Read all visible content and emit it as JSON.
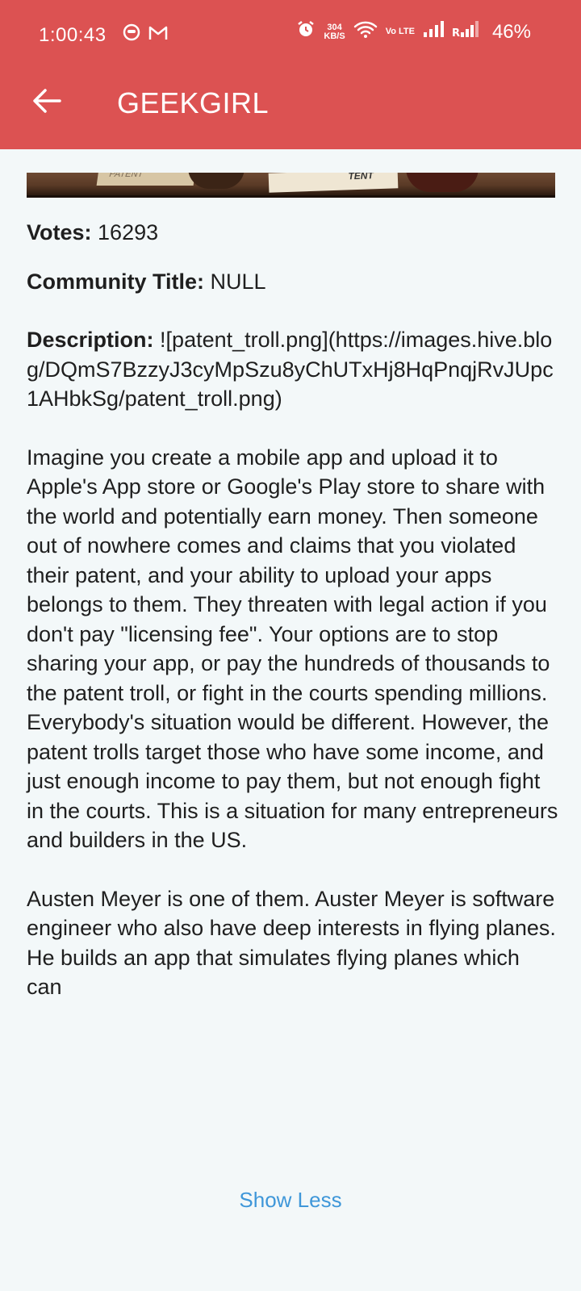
{
  "status_bar": {
    "time": "1:00:43",
    "speed_value": "304",
    "speed_unit": "KB/S",
    "network_label": "Vo LTE",
    "battery": "46%"
  },
  "app_bar": {
    "title": "GEEKGIRL",
    "background_color": "#dc5252"
  },
  "banner": {
    "paper_left_text": "PATENT",
    "paper_right_text": "TENT"
  },
  "details": {
    "votes_label": "Votes:",
    "votes_value": "16293",
    "community_label": "Community Title:",
    "community_value": "NULL",
    "description_label": "Description:",
    "description_value": "![patent_troll.png](https://images.hive.blog/DQmS7BzzyJ3cyMpSzu8yChUTxHj8HqPnqjRvJUpc1AHbkSg/patent_troll.png)",
    "paragraphs": [
      "Imagine you create a mobile app and upload it to Apple's App store or Google's Play store to share with the world and potentially earn money. Then someone out of nowhere comes and claims that you violated their patent, and your ability to upload your apps belongs to them. They threaten with legal action if you don't pay \"licensing fee\". Your options are to stop sharing your app, or pay the hundreds of thousands to the patent troll, or fight in the courts spending millions. Everybody's situation would be different. However, the patent trolls target those who have some income, and just enough income to pay them, but not enough fight in the courts. This is a situation for many entrepreneurs and builders in the US.",
      "Austen Meyer is one of them. Auster Meyer is software engineer who also have deep interests in flying planes. He builds an app that simulates flying planes which can"
    ]
  },
  "show_less_label": "Show Less",
  "colors": {
    "accent": "#3f97d9",
    "page_background": "#f3f8f9"
  }
}
